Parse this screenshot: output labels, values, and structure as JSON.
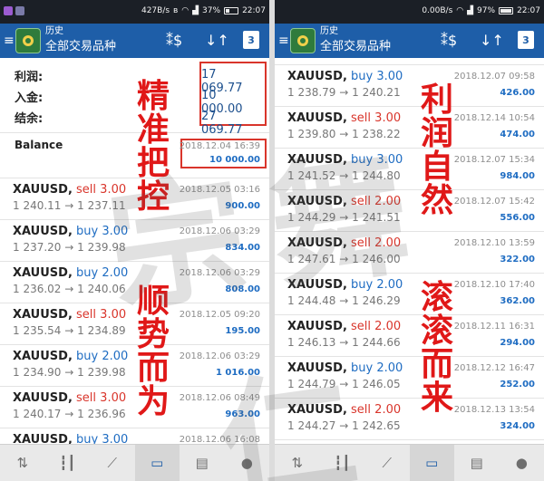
{
  "left": {
    "status": {
      "speed": "427B/s",
      "battery": "37%",
      "time": "22:07"
    },
    "appbar": {
      "title": "历史",
      "subtitle": "全部交易品种",
      "calendar_day": "3"
    },
    "summary": [
      {
        "label": "利润:",
        "value": "17 069.77"
      },
      {
        "label": "入金:",
        "value": "10 000.00"
      },
      {
        "label": "结余:",
        "value": "27 069.77"
      }
    ],
    "balance": {
      "label": "Balance",
      "date": "2018.12.04 16:39",
      "amount": "10 000.00"
    },
    "trades": [
      {
        "symbol": "XAUUSD,",
        "action": "sell",
        "volume": "3.00",
        "open": "1 240.11",
        "close": "1 237.11",
        "date": "2018.12.05 03:16",
        "profit": "900.00"
      },
      {
        "symbol": "XAUUSD,",
        "action": "buy",
        "volume": "3.00",
        "open": "1 237.20",
        "close": "1 239.98",
        "date": "2018.12.06 03:29",
        "profit": "834.00"
      },
      {
        "symbol": "XAUUSD,",
        "action": "buy",
        "volume": "2.00",
        "open": "1 236.02",
        "close": "1 240.06",
        "date": "2018.12.06 03:29",
        "profit": "808.00"
      },
      {
        "symbol": "XAUUSD,",
        "action": "sell",
        "volume": "3.00",
        "open": "1 235.54",
        "close": "1 234.89",
        "date": "2018.12.05 09:20",
        "profit": "195.00"
      },
      {
        "symbol": "XAUUSD,",
        "action": "buy",
        "volume": "2.00",
        "open": "1 234.90",
        "close": "1 239.98",
        "date": "2018.12.06 03:29",
        "profit": "1 016.00"
      },
      {
        "symbol": "XAUUSD,",
        "action": "sell",
        "volume": "3.00",
        "open": "1 240.17",
        "close": "1 236.96",
        "date": "2018.12.06 08:49",
        "profit": "963.00"
      }
    ],
    "partial_trade": {
      "symbol": "XAUUSD,",
      "action": "buy",
      "volume": "3.00",
      "date": "2018.12.06 16:08"
    },
    "calligraphy_a": [
      "精",
      "准",
      "把",
      "控"
    ],
    "calligraphy_b": [
      "顺",
      "势",
      "而",
      "为"
    ]
  },
  "right": {
    "status": {
      "speed": "0.00B/s",
      "battery": "97%",
      "time": "22:07"
    },
    "appbar": {
      "title": "历史",
      "subtitle": "全部交易品种",
      "calendar_day": "3"
    },
    "trades": [
      {
        "symbol": "XAUUSD,",
        "action": "buy",
        "volume": "3.00",
        "open": "1 238.79",
        "close": "1 240.21",
        "date": "2018.12.07 09:58",
        "profit": "426.00"
      },
      {
        "symbol": "XAUUSD,",
        "action": "sell",
        "volume": "3.00",
        "open": "1 239.80",
        "close": "1 238.22",
        "date": "2018.12.14 10:54",
        "profit": "474.00"
      },
      {
        "symbol": "XAUUSD,",
        "action": "buy",
        "volume": "3.00",
        "open": "1 241.52",
        "close": "1 244.80",
        "date": "2018.12.07 15:34",
        "profit": "984.00"
      },
      {
        "symbol": "XAUUSD,",
        "action": "sell",
        "volume": "2.00",
        "open": "1 244.29",
        "close": "1 241.51",
        "date": "2018.12.07 15:42",
        "profit": "556.00"
      },
      {
        "symbol": "XAUUSD,",
        "action": "sell",
        "volume": "2.00",
        "open": "1 247.61",
        "close": "1 246.00",
        "date": "2018.12.10 13:59",
        "profit": "322.00"
      },
      {
        "symbol": "XAUUSD,",
        "action": "buy",
        "volume": "2.00",
        "open": "1 244.48",
        "close": "1 246.29",
        "date": "2018.12.10 17:40",
        "profit": "362.00"
      },
      {
        "symbol": "XAUUSD,",
        "action": "sell",
        "volume": "2.00",
        "open": "1 246.13",
        "close": "1 244.66",
        "date": "2018.12.11 16:31",
        "profit": "294.00"
      },
      {
        "symbol": "XAUUSD,",
        "action": "buy",
        "volume": "2.00",
        "open": "1 244.79",
        "close": "1 246.05",
        "date": "2018.12.12 16:47",
        "profit": "252.00"
      },
      {
        "symbol": "XAUUSD,",
        "action": "sell",
        "volume": "2.00",
        "open": "1 244.27",
        "close": "1 242.65",
        "date": "2018.12.13 13:54",
        "profit": "324.00"
      }
    ],
    "calligraphy_a": [
      "利",
      "润",
      "自",
      "然"
    ],
    "calligraphy_b": [
      "滚",
      "滚",
      "而",
      "来"
    ]
  },
  "arrow": "→",
  "watermark": "宗舞仁",
  "colors": {
    "appbar": "#1e5ea8",
    "buy": "#1e6cc2",
    "sell": "#d9352b",
    "highlight_box": "#d9352b",
    "calligraphy": "#e01818"
  },
  "icons": {
    "appbar": [
      "menu-icon",
      "app-logo-icon",
      "symbol-filter-icon",
      "sort-icon",
      "calendar-icon"
    ],
    "bottom_nav": [
      "quotes-icon",
      "chart-icon",
      "trade-icon",
      "history-icon",
      "news-icon",
      "chat-icon"
    ]
  }
}
